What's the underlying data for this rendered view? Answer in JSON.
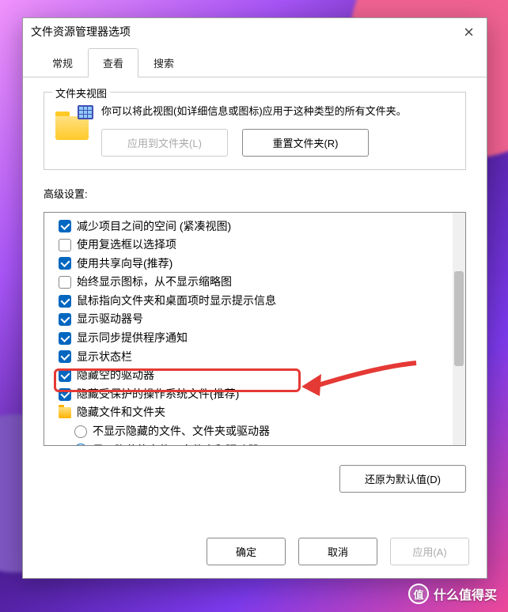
{
  "dialog": {
    "title": "文件资源管理器选项"
  },
  "tabs": {
    "general": "常规",
    "view": "查看",
    "search": "搜索"
  },
  "folderViews": {
    "legend": "文件夹视图",
    "text": "你可以将此视图(如详细信息或图标)应用于这种类型的所有文件夹。",
    "applyBtn": "应用到文件夹(L)",
    "resetBtn": "重置文件夹(R)"
  },
  "advanced": {
    "label": "高级设置:",
    "items": [
      {
        "type": "checkbox",
        "checked": true,
        "label": "减少项目之间的空间 (紧凑视图)"
      },
      {
        "type": "checkbox",
        "checked": false,
        "label": "使用复选框以选择项"
      },
      {
        "type": "checkbox",
        "checked": true,
        "label": "使用共享向导(推荐)"
      },
      {
        "type": "checkbox",
        "checked": false,
        "label": "始终显示图标，从不显示缩略图"
      },
      {
        "type": "checkbox",
        "checked": true,
        "label": "鼠标指向文件夹和桌面项时显示提示信息"
      },
      {
        "type": "checkbox",
        "checked": true,
        "label": "显示驱动器号"
      },
      {
        "type": "checkbox",
        "checked": true,
        "label": "显示同步提供程序通知"
      },
      {
        "type": "checkbox",
        "checked": true,
        "label": "显示状态栏"
      },
      {
        "type": "checkbox",
        "checked": true,
        "label": "隐藏空的驱动器"
      },
      {
        "type": "checkbox",
        "checked": true,
        "label": "隐藏受保护的操作系统文件(推荐)"
      },
      {
        "type": "category",
        "label": "隐藏文件和文件夹"
      },
      {
        "type": "radio",
        "checked": false,
        "sub": true,
        "label": "不显示隐藏的文件、文件夹或驱动器"
      },
      {
        "type": "radio",
        "checked": true,
        "sub": true,
        "label": "显示隐藏的文件、文件夹和驱动器"
      }
    ],
    "restoreBtn": "还原为默认值(D)"
  },
  "footer": {
    "ok": "确定",
    "cancel": "取消",
    "apply": "应用(A)"
  },
  "watermark": {
    "badge": "值",
    "text": "什么值得买"
  }
}
